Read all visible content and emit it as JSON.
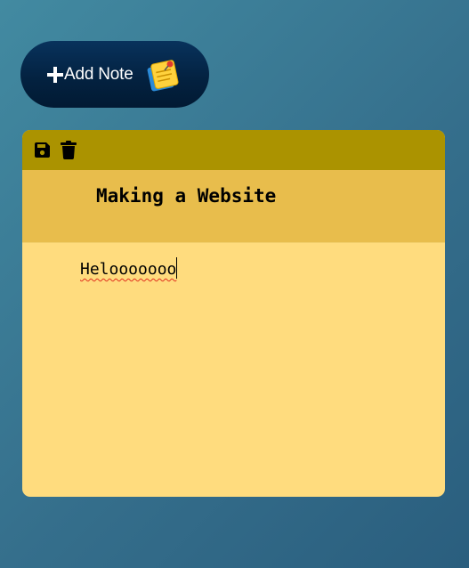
{
  "toolbar": {
    "add_note_label": "Add Note",
    "add_icon": "plus-icon",
    "sticky_icon": "sticky-note-icon"
  },
  "note": {
    "actions": [
      {
        "name": "save",
        "icon": "floppy-disk-icon"
      },
      {
        "name": "delete",
        "icon": "trash-icon"
      }
    ],
    "title": "Making a Website",
    "body": "Helooooooo"
  },
  "colors": {
    "background": "#3a7a96",
    "button": "#03213f",
    "toolbar": "#ab9300",
    "title_bg": "#e8bd4c",
    "body_bg": "#ffdc7e"
  }
}
